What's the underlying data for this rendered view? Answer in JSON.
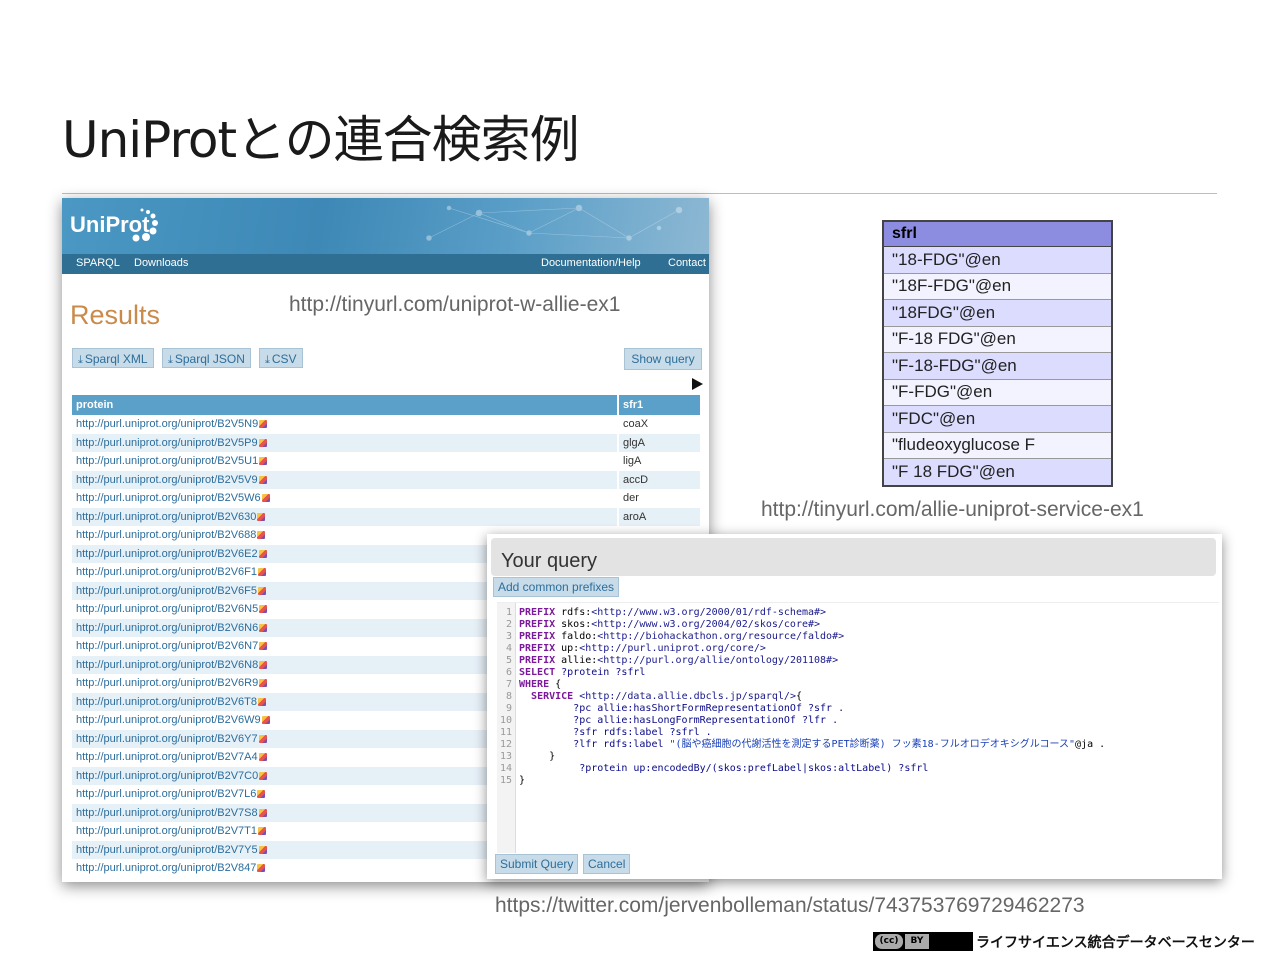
{
  "slide": {
    "title": "UniProtとの連合検索例",
    "caption_results": "http://tinyurl.com/uniprot-w-allie-ex1",
    "caption_service": "http://tinyurl.com/allie-uniprot-service-ex1",
    "caption_twitter": "https://twitter.com/jervenbolleman/status/743753769729462273"
  },
  "uniprot": {
    "logo": "UniProt",
    "nav": {
      "sparql": "SPARQL",
      "downloads": "Downloads",
      "docs": "Documentation/Help",
      "contact": "Contact"
    },
    "results_heading": "Results",
    "buttons": {
      "sparql_xml": "Sparql XML",
      "sparql_json": "Sparql JSON",
      "csv": "CSV",
      "show_query": "Show query"
    },
    "table": {
      "headers": [
        "protein",
        "sfr1"
      ],
      "rows": [
        {
          "uri": "http://purl.uniprot.org/uniprot/B2V5N9",
          "sfr": "coaX"
        },
        {
          "uri": "http://purl.uniprot.org/uniprot/B2V5P9",
          "sfr": "glgA"
        },
        {
          "uri": "http://purl.uniprot.org/uniprot/B2V5U1",
          "sfr": "ligA"
        },
        {
          "uri": "http://purl.uniprot.org/uniprot/B2V5V9",
          "sfr": "accD"
        },
        {
          "uri": "http://purl.uniprot.org/uniprot/B2V5W6",
          "sfr": "der"
        },
        {
          "uri": "http://purl.uniprot.org/uniprot/B2V630",
          "sfr": "aroA"
        },
        {
          "uri": "http://purl.uniprot.org/uniprot/B2V688",
          "sfr": ""
        },
        {
          "uri": "http://purl.uniprot.org/uniprot/B2V6E2",
          "sfr": ""
        },
        {
          "uri": "http://purl.uniprot.org/uniprot/B2V6F1",
          "sfr": ""
        },
        {
          "uri": "http://purl.uniprot.org/uniprot/B2V6F5",
          "sfr": ""
        },
        {
          "uri": "http://purl.uniprot.org/uniprot/B2V6N5",
          "sfr": ""
        },
        {
          "uri": "http://purl.uniprot.org/uniprot/B2V6N6",
          "sfr": ""
        },
        {
          "uri": "http://purl.uniprot.org/uniprot/B2V6N7",
          "sfr": ""
        },
        {
          "uri": "http://purl.uniprot.org/uniprot/B2V6N8",
          "sfr": ""
        },
        {
          "uri": "http://purl.uniprot.org/uniprot/B2V6R9",
          "sfr": ""
        },
        {
          "uri": "http://purl.uniprot.org/uniprot/B2V6T8",
          "sfr": ""
        },
        {
          "uri": "http://purl.uniprot.org/uniprot/B2V6W9",
          "sfr": ""
        },
        {
          "uri": "http://purl.uniprot.org/uniprot/B2V6Y7",
          "sfr": ""
        },
        {
          "uri": "http://purl.uniprot.org/uniprot/B2V7A4",
          "sfr": ""
        },
        {
          "uri": "http://purl.uniprot.org/uniprot/B2V7C0",
          "sfr": ""
        },
        {
          "uri": "http://purl.uniprot.org/uniprot/B2V7L6",
          "sfr": ""
        },
        {
          "uri": "http://purl.uniprot.org/uniprot/B2V7S8",
          "sfr": ""
        },
        {
          "uri": "http://purl.uniprot.org/uniprot/B2V7T1",
          "sfr": ""
        },
        {
          "uri": "http://purl.uniprot.org/uniprot/B2V7Y5",
          "sfr": ""
        },
        {
          "uri": "http://purl.uniprot.org/uniprot/B2V847",
          "sfr": ""
        }
      ]
    }
  },
  "sfrl_table": {
    "header": "sfrl",
    "rows": [
      "\"18-FDG\"@en",
      "\"18F-FDG\"@en",
      "\"18FDG\"@en",
      "\"F-18 FDG\"@en",
      "\"F-18-FDG\"@en",
      "\"F-FDG\"@en",
      "\"FDC\"@en",
      "\"fludeoxyglucose F",
      "\"F 18 FDG\"@en"
    ]
  },
  "query_panel": {
    "title": "Your query",
    "add_prefixes": "Add common prefixes",
    "submit": "Submit Query",
    "cancel": "Cancel",
    "lines": [
      [
        {
          "t": "PREFIX",
          "c": "kw"
        },
        {
          "t": " rdfs:",
          "c": ""
        },
        {
          "t": "<http://www.w3.org/2000/01/rdf-schema#>",
          "c": "uri-t"
        }
      ],
      [
        {
          "t": "PREFIX",
          "c": "kw"
        },
        {
          "t": " skos:",
          "c": ""
        },
        {
          "t": "<http://www.w3.org/2004/02/skos/core#>",
          "c": "uri-t"
        }
      ],
      [
        {
          "t": "PREFIX",
          "c": "kw"
        },
        {
          "t": " faldo:",
          "c": ""
        },
        {
          "t": "<http://biohackathon.org/resource/faldo#>",
          "c": "uri-t"
        }
      ],
      [
        {
          "t": "PREFIX",
          "c": "kw"
        },
        {
          "t": " up:",
          "c": ""
        },
        {
          "t": "<http://purl.uniprot.org/core/>",
          "c": "uri-t"
        }
      ],
      [
        {
          "t": "PREFIX",
          "c": "kw"
        },
        {
          "t": " allie:",
          "c": ""
        },
        {
          "t": "<http://purl.org/allie/ontology/201108#>",
          "c": "uri-t"
        }
      ],
      [
        {
          "t": "SELECT",
          "c": "kw"
        },
        {
          "t": " ?protein ?sfrl",
          "c": "var"
        }
      ],
      [
        {
          "t": "WHERE",
          "c": "kw"
        },
        {
          "t": " {",
          "c": ""
        }
      ],
      [
        {
          "t": "  ",
          "c": ""
        },
        {
          "t": "SERVICE",
          "c": "kw"
        },
        {
          "t": " ",
          "c": ""
        },
        {
          "t": "<http://data.allie.dbcls.jp/sparql/>",
          "c": "uri-t"
        },
        {
          "t": "{",
          "c": ""
        }
      ],
      [
        {
          "t": "         ?pc allie:hasShortFormRepresentationOf ?sfr .",
          "c": "var"
        }
      ],
      [
        {
          "t": "         ?pc allie:hasLongFormRepresentationOf ?lfr .",
          "c": "var"
        }
      ],
      [
        {
          "t": "         ?sfr rdfs:label ?sfrl .",
          "c": "var"
        }
      ],
      [
        {
          "t": "         ?lfr rdfs:label ",
          "c": "var"
        },
        {
          "t": "\"(脳や癌細胞の代謝活性を測定するPET診断薬) フッ素18-フルオロデオキシグルコース\"",
          "c": "str"
        },
        {
          "t": "@ja .",
          "c": ""
        }
      ],
      [
        {
          "t": "     }",
          "c": ""
        }
      ],
      [
        {
          "t": "          ?protein up:encodedBy/(skos:prefLabel|skos:altLabel) ?sfrl",
          "c": "var"
        }
      ],
      [
        {
          "t": "}",
          "c": ""
        }
      ]
    ]
  },
  "footer": {
    "cc": "(cc)",
    "by": "BY",
    "org": "ライフサイエンス統合データベースセンター"
  }
}
